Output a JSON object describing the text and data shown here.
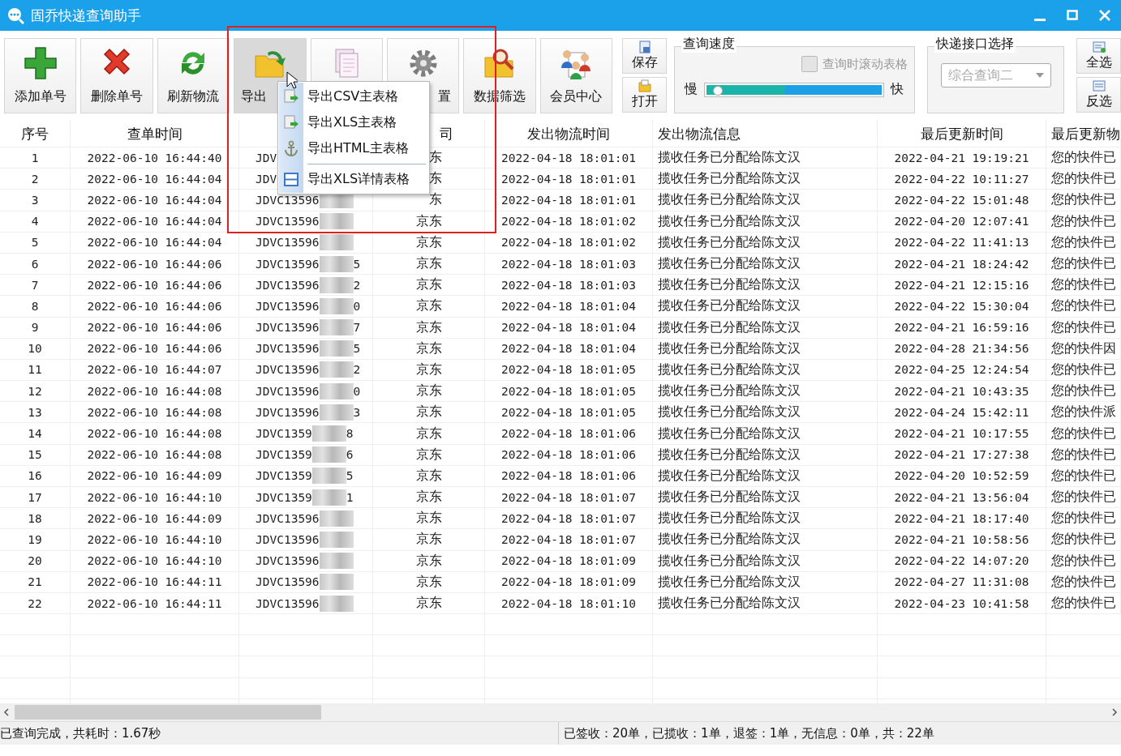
{
  "window": {
    "title": "固乔快递查询助手"
  },
  "toolbar": {
    "buttons": [
      {
        "label": "添加单号",
        "pressed": false
      },
      {
        "label": "删除单号",
        "pressed": false
      },
      {
        "label": "刷新物流",
        "pressed": false
      },
      {
        "label": "导出",
        "pressed": true
      },
      {
        "pressed": false
      },
      {
        "label": "置",
        "pressed": false,
        "label_covered": true
      },
      {
        "label": "数据筛选",
        "pressed": false
      },
      {
        "label": "会员中心",
        "pressed": false
      }
    ],
    "file_buttons": [
      "保存",
      "打开"
    ],
    "speed_group": {
      "title": "查询速度",
      "scroll_checkbox": {
        "label": "查询时滚动表格",
        "checked": false,
        "disabled": true
      },
      "slow_label": "慢",
      "fast_label": "快",
      "slider": {
        "level": 0.03
      }
    },
    "interface_group": {
      "title": "快递接口选择",
      "dropdown": {
        "value": "综合查询二",
        "disabled": true
      }
    },
    "select_buttons": [
      "全选",
      "反选"
    ]
  },
  "export_menu": {
    "items": [
      {
        "label": "导出CSV主表格",
        "separator_after": false
      },
      {
        "label": "导出XLS主表格",
        "separator_after": false
      },
      {
        "label": "导出HTML主表格",
        "separator_after": true
      },
      {
        "label": "导出XLS详情表格",
        "separator_after": false
      }
    ]
  },
  "table": {
    "columns": [
      {
        "label": "序号"
      },
      {
        "label": "查单时间"
      },
      {
        "covered": true
      },
      {
        "label": "司",
        "label_covered": true
      },
      {
        "label": "发出物流时间"
      },
      {
        "label": "发出物流信息"
      },
      {
        "label": "最后更新时间"
      },
      {
        "label": "最后更新物"
      }
    ],
    "rows": [
      {
        "no": "1",
        "query_time": "2022-06-10 16:44:40",
        "tracking": "JDV",
        "redacted": false,
        "carrier": "东",
        "carrier_covered": true,
        "ship_time": "2022-04-18 18:01:01",
        "ship_info": "揽收任务已分配给陈文汉",
        "last_time": "2022-04-21 19:19:21",
        "last_info": "您的快件已"
      },
      {
        "no": "2",
        "query_time": "2022-06-10 16:44:04",
        "tracking": "JDV",
        "redacted": false,
        "carrier": "东",
        "carrier_covered": true,
        "ship_time": "2022-04-18 18:01:01",
        "ship_info": "揽收任务已分配给陈文汉",
        "last_time": "2022-04-22 10:11:27",
        "last_info": "您的快件已"
      },
      {
        "no": "3",
        "query_time": "2022-06-10 16:44:04",
        "tracking": "JDVC13596",
        "redacted": true,
        "carrier": "东",
        "carrier_covered": true,
        "ship_time": "2022-04-18 18:01:01",
        "ship_info": "揽收任务已分配给陈文汉",
        "last_time": "2022-04-22 15:01:48",
        "last_info": "您的快件已"
      },
      {
        "no": "4",
        "query_time": "2022-06-10 16:44:04",
        "tracking": "JDVC13596",
        "redacted": true,
        "carrier": "京东",
        "ship_time": "2022-04-18 18:01:02",
        "ship_info": "揽收任务已分配给陈文汉",
        "last_time": "2022-04-20 12:07:41",
        "last_info": "您的快件已"
      },
      {
        "no": "5",
        "query_time": "2022-06-10 16:44:04",
        "tracking": "JDVC13596",
        "redacted": true,
        "carrier": "京东",
        "ship_time": "2022-04-18 18:01:02",
        "ship_info": "揽收任务已分配给陈文汉",
        "last_time": "2022-04-22 11:41:13",
        "last_info": "您的快件已"
      },
      {
        "no": "6",
        "query_time": "2022-06-10 16:44:06",
        "tracking": "JDVC13596",
        "redacted": true,
        "tail": "5",
        "carrier": "京东",
        "ship_time": "2022-04-18 18:01:03",
        "ship_info": "揽收任务已分配给陈文汉",
        "last_time": "2022-04-21 18:24:42",
        "last_info": "您的快件已"
      },
      {
        "no": "7",
        "query_time": "2022-06-10 16:44:06",
        "tracking": "JDVC13596",
        "redacted": true,
        "tail": "2",
        "carrier": "京东",
        "ship_time": "2022-04-18 18:01:03",
        "ship_info": "揽收任务已分配给陈文汉",
        "last_time": "2022-04-21 12:15:16",
        "last_info": "您的快件已"
      },
      {
        "no": "8",
        "query_time": "2022-06-10 16:44:06",
        "tracking": "JDVC13596",
        "redacted": true,
        "tail": "0",
        "carrier": "京东",
        "ship_time": "2022-04-18 18:01:04",
        "ship_info": "揽收任务已分配给陈文汉",
        "last_time": "2022-04-22 15:30:04",
        "last_info": "您的快件已"
      },
      {
        "no": "9",
        "query_time": "2022-06-10 16:44:06",
        "tracking": "JDVC13596",
        "redacted": true,
        "tail": "7",
        "carrier": "京东",
        "ship_time": "2022-04-18 18:01:04",
        "ship_info": "揽收任务已分配给陈文汉",
        "last_time": "2022-04-21 16:59:16",
        "last_info": "您的快件已"
      },
      {
        "no": "10",
        "query_time": "2022-06-10 16:44:06",
        "tracking": "JDVC13596",
        "redacted": true,
        "tail": "5",
        "carrier": "京东",
        "ship_time": "2022-04-18 18:01:04",
        "ship_info": "揽收任务已分配给陈文汉",
        "last_time": "2022-04-28 21:34:56",
        "last_info": "您的快件因"
      },
      {
        "no": "11",
        "query_time": "2022-06-10 16:44:07",
        "tracking": "JDVC13596",
        "redacted": true,
        "tail": "2",
        "carrier": "京东",
        "ship_time": "2022-04-18 18:01:05",
        "ship_info": "揽收任务已分配给陈文汉",
        "last_time": "2022-04-25 12:24:54",
        "last_info": "您的快件已"
      },
      {
        "no": "12",
        "query_time": "2022-06-10 16:44:08",
        "tracking": "JDVC13596",
        "redacted": true,
        "tail": "0",
        "carrier": "京东",
        "ship_time": "2022-04-18 18:01:05",
        "ship_info": "揽收任务已分配给陈文汉",
        "last_time": "2022-04-21 10:43:35",
        "last_info": "您的快件已"
      },
      {
        "no": "13",
        "query_time": "2022-06-10 16:44:08",
        "tracking": "JDVC13596",
        "redacted": true,
        "tail": "3",
        "carrier": "京东",
        "ship_time": "2022-04-18 18:01:05",
        "ship_info": "揽收任务已分配给陈文汉",
        "last_time": "2022-04-24 15:42:11",
        "last_info": "您的快件派"
      },
      {
        "no": "14",
        "query_time": "2022-06-10 16:44:08",
        "tracking": "JDVC1359",
        "redacted": true,
        "tail": "8",
        "carrier": "京东",
        "ship_time": "2022-04-18 18:01:06",
        "ship_info": "揽收任务已分配给陈文汉",
        "last_time": "2022-04-21 10:17:55",
        "last_info": "您的快件已"
      },
      {
        "no": "15",
        "query_time": "2022-06-10 16:44:08",
        "tracking": "JDVC1359",
        "redacted": true,
        "tail": "6",
        "carrier": "京东",
        "ship_time": "2022-04-18 18:01:06",
        "ship_info": "揽收任务已分配给陈文汉",
        "last_time": "2022-04-21 17:27:38",
        "last_info": "您的快件已"
      },
      {
        "no": "16",
        "query_time": "2022-06-10 16:44:09",
        "tracking": "JDVC1359",
        "redacted": true,
        "tail": "5",
        "carrier": "京东",
        "ship_time": "2022-04-18 18:01:06",
        "ship_info": "揽收任务已分配给陈文汉",
        "last_time": "2022-04-20 10:52:59",
        "last_info": "您的快件已"
      },
      {
        "no": "17",
        "query_time": "2022-06-10 16:44:10",
        "tracking": "JDVC1359",
        "redacted": true,
        "tail": "1",
        "carrier": "京东",
        "ship_time": "2022-04-18 18:01:07",
        "ship_info": "揽收任务已分配给陈文汉",
        "last_time": "2022-04-21 13:56:04",
        "last_info": "您的快件已"
      },
      {
        "no": "18",
        "query_time": "2022-06-10 16:44:09",
        "tracking": "JDVC13596",
        "redacted": true,
        "carrier": "京东",
        "ship_time": "2022-04-18 18:01:07",
        "ship_info": "揽收任务已分配给陈文汉",
        "last_time": "2022-04-21 18:17:40",
        "last_info": "您的快件已"
      },
      {
        "no": "19",
        "query_time": "2022-06-10 16:44:10",
        "tracking": "JDVC13596",
        "redacted": true,
        "carrier": "京东",
        "ship_time": "2022-04-18 18:01:07",
        "ship_info": "揽收任务已分配给陈文汉",
        "last_time": "2022-04-21 10:58:56",
        "last_info": "您的快件已"
      },
      {
        "no": "20",
        "query_time": "2022-06-10 16:44:10",
        "tracking": "JDVC13596",
        "redacted": true,
        "carrier": "京东",
        "ship_time": "2022-04-18 18:01:09",
        "ship_info": "揽收任务已分配给陈文汉",
        "last_time": "2022-04-22 14:07:20",
        "last_info": "您的快件已"
      },
      {
        "no": "21",
        "query_time": "2022-06-10 16:44:11",
        "tracking": "JDVC13596",
        "redacted": true,
        "carrier": "京东",
        "ship_time": "2022-04-18 18:01:09",
        "ship_info": "揽收任务已分配给陈文汉",
        "last_time": "2022-04-27 11:31:08",
        "last_info": "您的快件已"
      },
      {
        "no": "22",
        "query_time": "2022-06-10 16:44:11",
        "tracking": "JDVC13596",
        "redacted": true,
        "carrier": "京东",
        "ship_time": "2022-04-18 18:01:10",
        "ship_info": "揽收任务已分配给陈文汉",
        "last_time": "2022-04-23 10:41:58",
        "last_info": "您的快件已"
      }
    ]
  },
  "status_bar": {
    "left": "已查询完成，共耗时：1.67秒",
    "right": "已签收：20单，已揽收：1单，退签：1单，无信息：0单，共：22单"
  }
}
